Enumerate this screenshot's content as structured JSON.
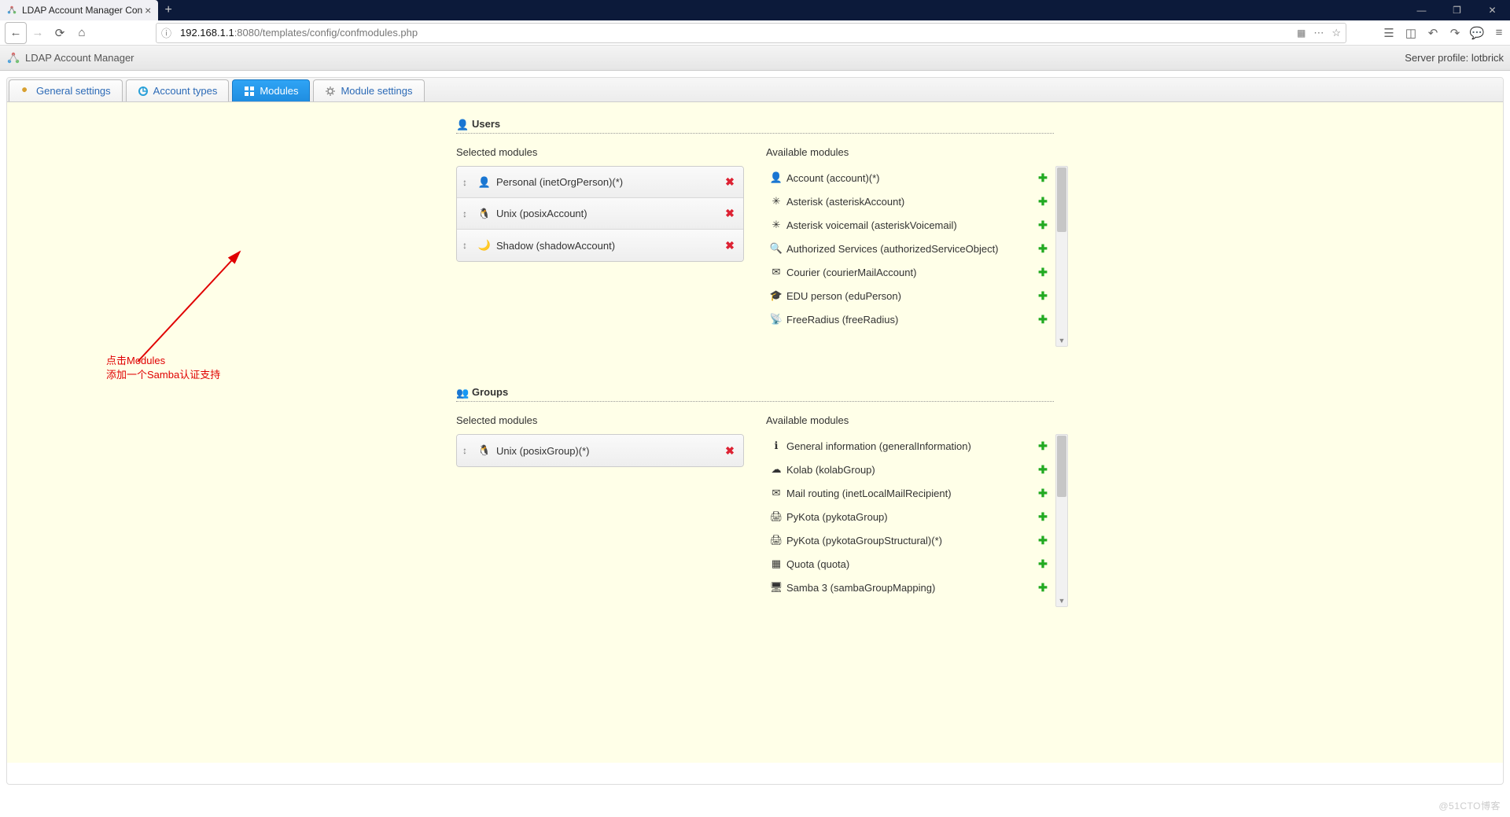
{
  "browser": {
    "tab_title": "LDAP Account Manager Con",
    "url_host": "192.168.1.1",
    "url_rest": ":8080/templates/config/confmodules.php"
  },
  "header": {
    "app_name": "LDAP Account Manager",
    "profile_label": "Server profile: lotbrick"
  },
  "tabs": {
    "general": "General settings",
    "accounts": "Account types",
    "modules": "Modules",
    "modsettings": "Module settings"
  },
  "sections": {
    "users": {
      "title": "Users",
      "selected_label": "Selected modules",
      "available_label": "Available modules",
      "selected": [
        {
          "icon": "👤",
          "label": "Personal (inetOrgPerson)(*)"
        },
        {
          "icon": "🐧",
          "label": "Unix (posixAccount)"
        },
        {
          "icon": "🌙",
          "label": "Shadow (shadowAccount)"
        }
      ],
      "available": [
        {
          "icon": "👤",
          "label": "Account (account)(*)"
        },
        {
          "icon": "✳",
          "label": "Asterisk (asteriskAccount)"
        },
        {
          "icon": "✳",
          "label": "Asterisk voicemail (asteriskVoicemail)"
        },
        {
          "icon": "🔍",
          "label": "Authorized Services (authorizedServiceObject)"
        },
        {
          "icon": "✉",
          "label": "Courier (courierMailAccount)"
        },
        {
          "icon": "🎓",
          "label": "EDU person (eduPerson)"
        },
        {
          "icon": "📡",
          "label": "FreeRadius (freeRadius)"
        }
      ]
    },
    "groups": {
      "title": "Groups",
      "selected_label": "Selected modules",
      "available_label": "Available modules",
      "selected": [
        {
          "icon": "🐧",
          "label": "Unix (posixGroup)(*)"
        }
      ],
      "available": [
        {
          "icon": "ℹ",
          "label": "General information (generalInformation)"
        },
        {
          "icon": "☁",
          "label": "Kolab (kolabGroup)"
        },
        {
          "icon": "✉",
          "label": "Mail routing (inetLocalMailRecipient)"
        },
        {
          "icon": "🖨",
          "label": "PyKota (pykotaGroup)"
        },
        {
          "icon": "🖨",
          "label": "PyKota (pykotaGroupStructural)(*)"
        },
        {
          "icon": "▦",
          "label": "Quota (quota)"
        },
        {
          "icon": "🖥",
          "label": "Samba 3 (sambaGroupMapping)"
        }
      ]
    }
  },
  "annotation": {
    "line1": "点击Modules",
    "line2": "添加一个Samba认证支持"
  },
  "watermark": "@51CTO博客"
}
